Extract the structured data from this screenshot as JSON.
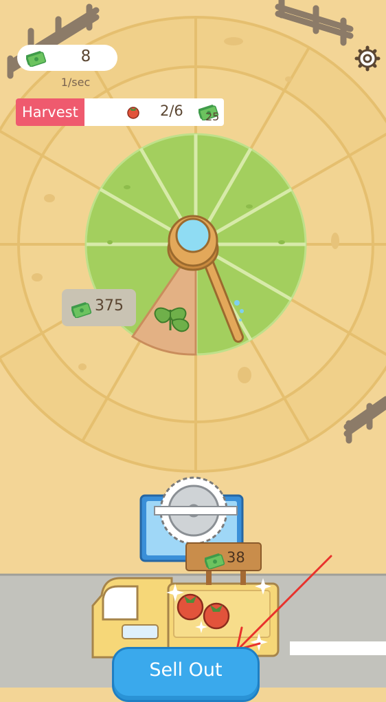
{
  "hud": {
    "money_value": "8",
    "rate_label": "1/sec",
    "settings_icon": "gear-icon"
  },
  "harvest": {
    "label": "Harvest",
    "progress": "2/6",
    "reward": "25",
    "progress_fraction": 0.333
  },
  "field": {
    "unlock_price": "375",
    "crop_icon": "seedling-icon",
    "tool_icon": "magnifier-hoe-icon"
  },
  "truck": {
    "sign_price": "38",
    "cargo_icon": "tomato-icon"
  },
  "sell_button": {
    "label": "Sell Out"
  },
  "colors": {
    "background": "#f3d596",
    "field_green": "#a3cf5e",
    "harvest_red": "#ef5a6e",
    "button_blue": "#3aa9ec",
    "annotation_arrow": "#e8322c"
  }
}
